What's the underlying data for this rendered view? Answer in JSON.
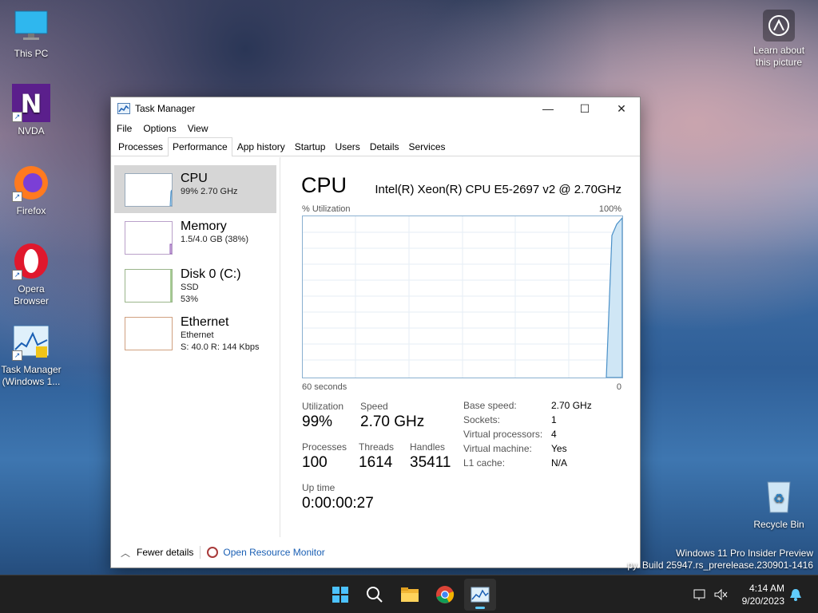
{
  "desktop": {
    "icons": [
      {
        "label": "This PC"
      },
      {
        "label": "NVDA"
      },
      {
        "label": "Firefox"
      },
      {
        "label": "Opera Browser"
      },
      {
        "label": "Task Manager (Windows 1..."
      },
      {
        "label": "Recycle Bin"
      }
    ],
    "learn_about": "Learn about this picture",
    "watermark_line1": "Windows 11 Pro Insider Preview",
    "watermark_line2": "py. Build 25947.rs_prerelease.230901-1416"
  },
  "window": {
    "title": "Task Manager",
    "controls": {
      "minimize": "—",
      "maximize": "☐",
      "close": "✕"
    },
    "menu": [
      "File",
      "Options",
      "View"
    ],
    "tabs": [
      "Processes",
      "Performance",
      "App history",
      "Startup",
      "Users",
      "Details",
      "Services"
    ],
    "active_tab": "Performance",
    "sidebar": [
      {
        "name": "CPU",
        "sub1": "99%  2.70 GHz",
        "sub2": "",
        "sub3": ""
      },
      {
        "name": "Memory",
        "sub1": "1.5/4.0 GB (38%)",
        "sub2": "",
        "sub3": ""
      },
      {
        "name": "Disk 0 (C:)",
        "sub1": "SSD",
        "sub2": "53%",
        "sub3": ""
      },
      {
        "name": "Ethernet",
        "sub1": "Ethernet",
        "sub2": "S: 40.0  R: 144 Kbps",
        "sub3": ""
      }
    ],
    "cpu": {
      "title": "CPU",
      "model": "Intel(R) Xeon(R) CPU E5-2697 v2 @ 2.70GHz",
      "graph_label_left": "% Utilization",
      "graph_label_right": "100%",
      "time_left": "60 seconds",
      "time_right": "0",
      "utilization_label": "Utilization",
      "utilization": "99%",
      "speed_label": "Speed",
      "speed": "2.70 GHz",
      "processes_label": "Processes",
      "processes": "100",
      "threads_label": "Threads",
      "threads": "1614",
      "handles_label": "Handles",
      "handles": "35411",
      "uptime_label": "Up time",
      "uptime": "0:00:00:27",
      "details": [
        {
          "k": "Base speed:",
          "v": "2.70 GHz"
        },
        {
          "k": "Sockets:",
          "v": "1"
        },
        {
          "k": "Virtual processors:",
          "v": "4"
        },
        {
          "k": "Virtual machine:",
          "v": "Yes"
        },
        {
          "k": "L1 cache:",
          "v": "N/A"
        }
      ]
    },
    "footer": {
      "fewer": "Fewer details",
      "resmon": "Open Resource Monitor"
    }
  },
  "taskbar": {
    "time": "4:14 AM",
    "date": "9/20/2023",
    "apps": [
      "start-icon",
      "search-icon",
      "file-explorer-icon",
      "chrome-icon",
      "task-manager-icon"
    ]
  },
  "colors": {
    "accent": "#60cdff",
    "graph_line": "#4a90c8",
    "graph_fill": "#cfe6f5"
  }
}
